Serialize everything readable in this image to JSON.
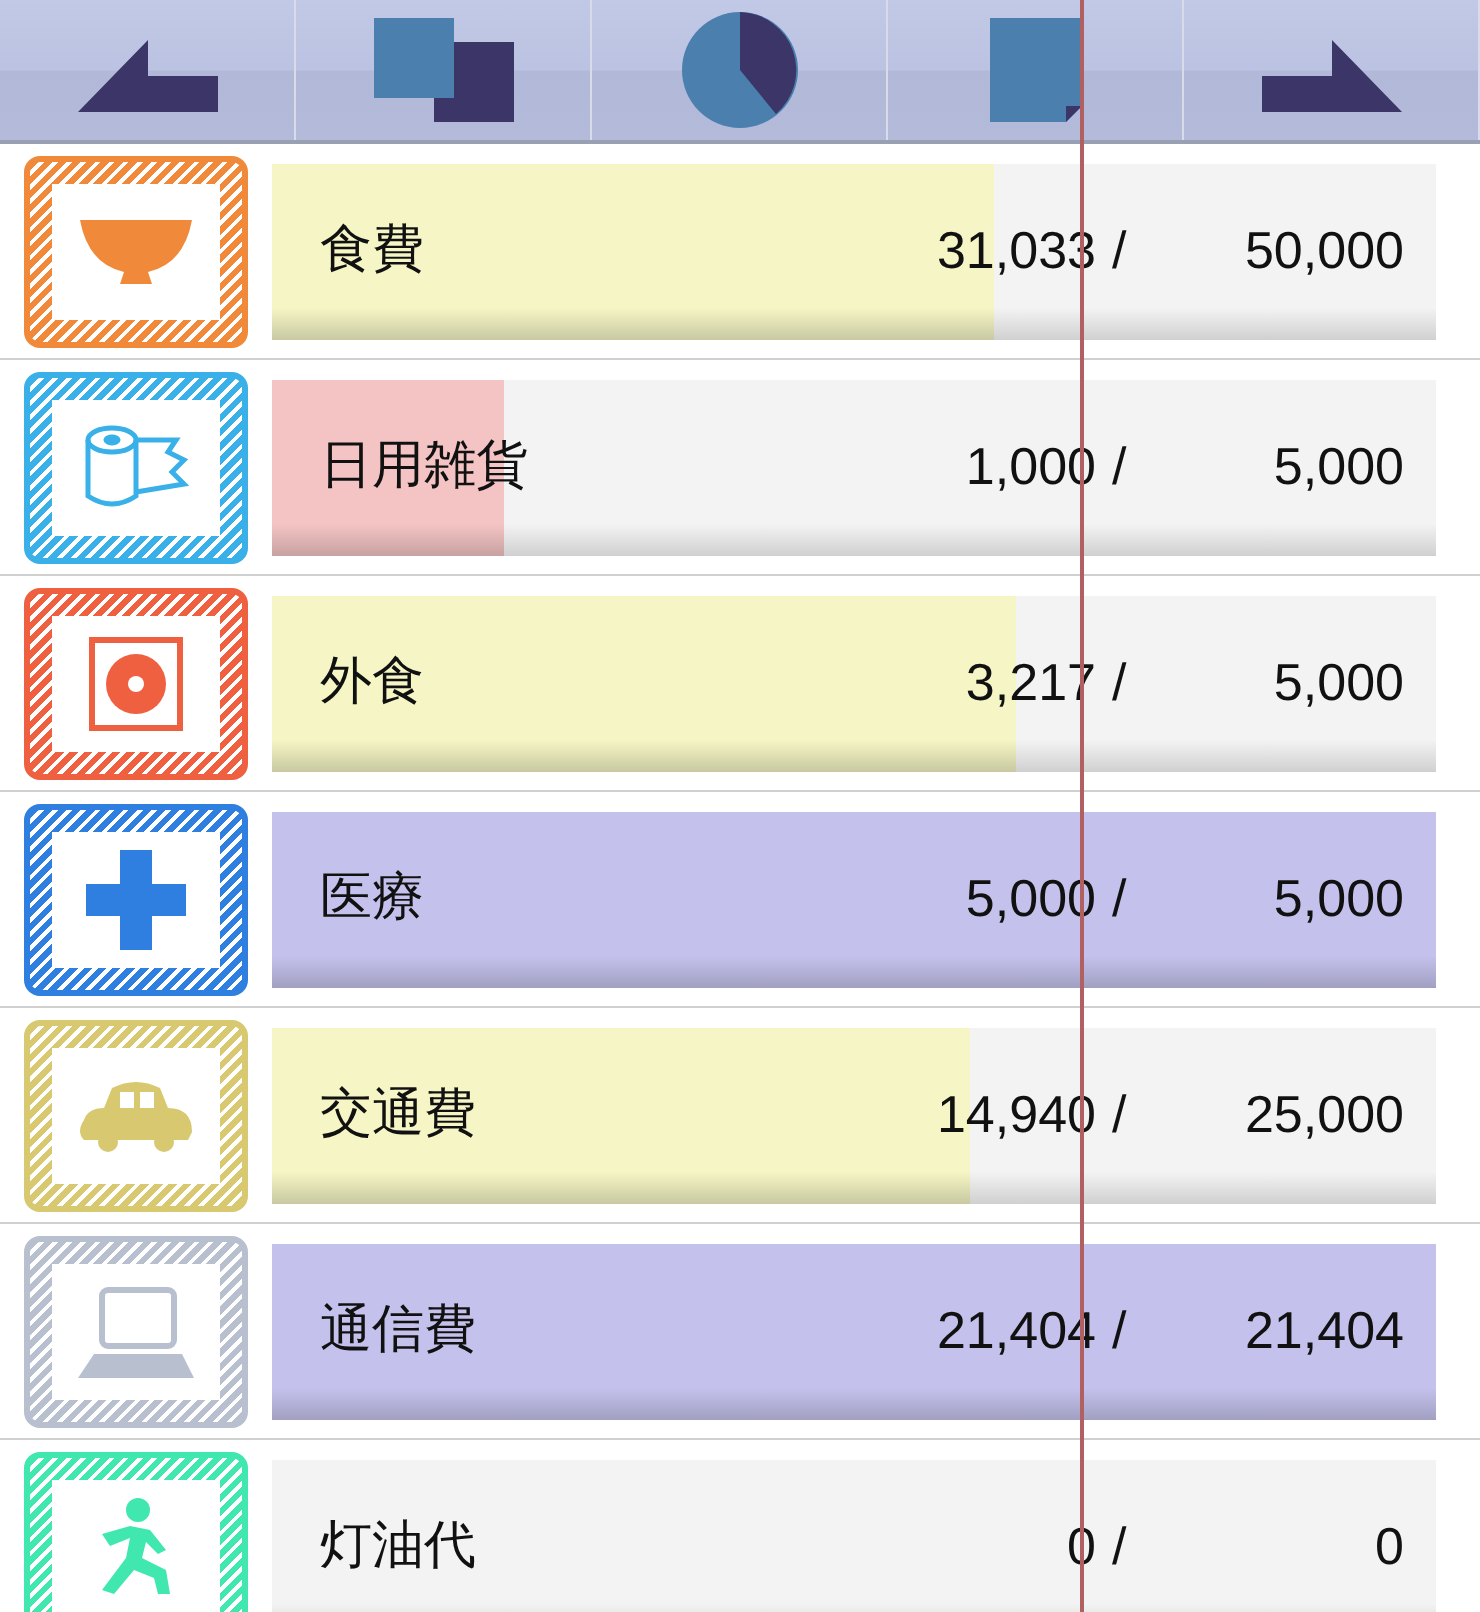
{
  "toolbar": [
    {
      "kind": "back"
    },
    {
      "kind": "copy"
    },
    {
      "kind": "pie"
    },
    {
      "kind": "page"
    },
    {
      "kind": "forward"
    }
  ],
  "budgets": [
    {
      "name": "食費",
      "icon": {
        "kind": "bowl",
        "color": "#f08a3a"
      },
      "bar": {
        "color": "#f5f5c5",
        "level": 0.62
      },
      "spent": "31,033",
      "budget": "50,000"
    },
    {
      "name": "日用雑貨",
      "icon": {
        "kind": "tissue",
        "color": "#3ab0e8"
      },
      "bar": {
        "color": "#f4c4c4",
        "level": 0.2
      },
      "spent": "1,000",
      "budget": "5,000"
    },
    {
      "name": "外食",
      "icon": {
        "kind": "disc",
        "color": "#ee6040"
      },
      "bar": {
        "color": "#f5f5c5",
        "level": 0.64
      },
      "spent": "3,217",
      "budget": "5,000"
    },
    {
      "name": "医療",
      "icon": {
        "kind": "cross",
        "color": "#2e7fe0"
      },
      "bar": {
        "color": "#c4c2ec",
        "level": 1
      },
      "spent": "5,000",
      "budget": "5,000"
    },
    {
      "name": "交通費",
      "icon": {
        "kind": "car",
        "color": "#d8c870"
      },
      "bar": {
        "color": "#f5f5c5",
        "level": 0.6
      },
      "spent": "14,940",
      "budget": "25,000"
    },
    {
      "name": "通信費",
      "icon": {
        "kind": "laptop",
        "color": "#b8c0d0"
      },
      "bar": {
        "color": "#c4c2ec",
        "level": 1
      },
      "spent": "21,404",
      "budget": "21,404"
    },
    {
      "name": "灯油代",
      "icon": {
        "kind": "runner",
        "color": "#40e8b0"
      },
      "spent": "0",
      "budget": "0"
    }
  ],
  "separator": "/"
}
